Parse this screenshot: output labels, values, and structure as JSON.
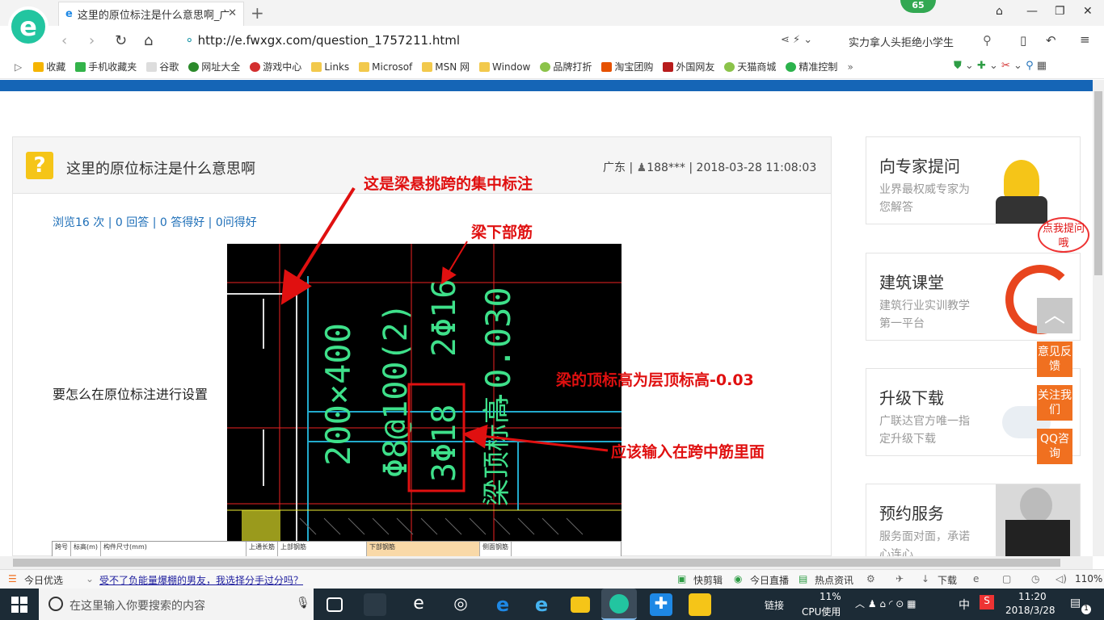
{
  "browser": {
    "tab_title": "这里的原位标注是什么意思啊_广",
    "badge": "65",
    "url_prefix": "http://",
    "url": "e.fwxgx.com/question_1757211.html",
    "hot_search": "实力拿人头拒绝小学生",
    "favorites": [
      "收藏",
      "手机收藏夹",
      "谷歌",
      "网址大全",
      "游戏中心",
      "Links",
      "Microsof",
      "MSN 网",
      "Window",
      "品牌打折",
      "淘宝团购",
      "外国网友",
      "天猫商城",
      "精准控制"
    ]
  },
  "question": {
    "title": "这里的原位标注是什么意思啊",
    "region": "广东",
    "user": "188***",
    "datetime": "2018-03-28 11:08:03",
    "stats": "浏览16 次 | 0 回答 | 0 答得好 | 0问得好",
    "body": "要怎么在原位标注进行设置"
  },
  "annotations": {
    "concentrated": "这是梁悬挑跨的集中标注",
    "bottom_bar": "梁下部筋",
    "top_elev": "梁的顶标高为层顶标高-0.03",
    "input_mid": "应该输入在跨中筋里面"
  },
  "cad": {
    "text1": "200×400",
    "text2": "Φ8@100(2)",
    "text3": "2Φ16",
    "text4": "-0.030",
    "text5": "3Φ18",
    "text6": "梁顶标高"
  },
  "table_strip": [
    "跨号",
    "标高(m)",
    "构件尺寸(mm)",
    "上通长筋",
    "上部钢筋",
    "下部钢筋",
    "侧面钢筋"
  ],
  "sidebar": [
    {
      "title": "向专家提问",
      "sub": "业界最权威专家为您解答"
    },
    {
      "title": "建筑课堂",
      "sub": "建筑行业实训教学第一平台"
    },
    {
      "title": "升级下载",
      "sub": "广联达官方唯一指定升级下载"
    },
    {
      "title": "预约服务",
      "sub": "服务面对面，承诺心连心"
    }
  ],
  "mascot_bubble": "点我提问哦",
  "float_buttons": [
    "意见反馈",
    "关注我们",
    "QQ咨询"
  ],
  "statusbar": {
    "left": "今日优选",
    "news": "受不了负能量爆棚的男友，我选择分手过分吗？",
    "kuaijian": "快剪辑",
    "live": "今日直播",
    "hotnews": "热点资讯",
    "download": "下载",
    "zoom": "110%"
  },
  "taskbar": {
    "search_placeholder": "在这里输入你要搜索的内容",
    "link_label": "链接",
    "cpu_pct": "11%",
    "cpu_label": "CPU使用",
    "ime": "中",
    "time": "11:20",
    "date": "2018/3/28",
    "notif": "1"
  },
  "colors": {
    "brand_blue": "#1565b6",
    "accent_orange": "#f07020",
    "annotation_red": "#e01010",
    "cad_green": "#3ee08a"
  }
}
